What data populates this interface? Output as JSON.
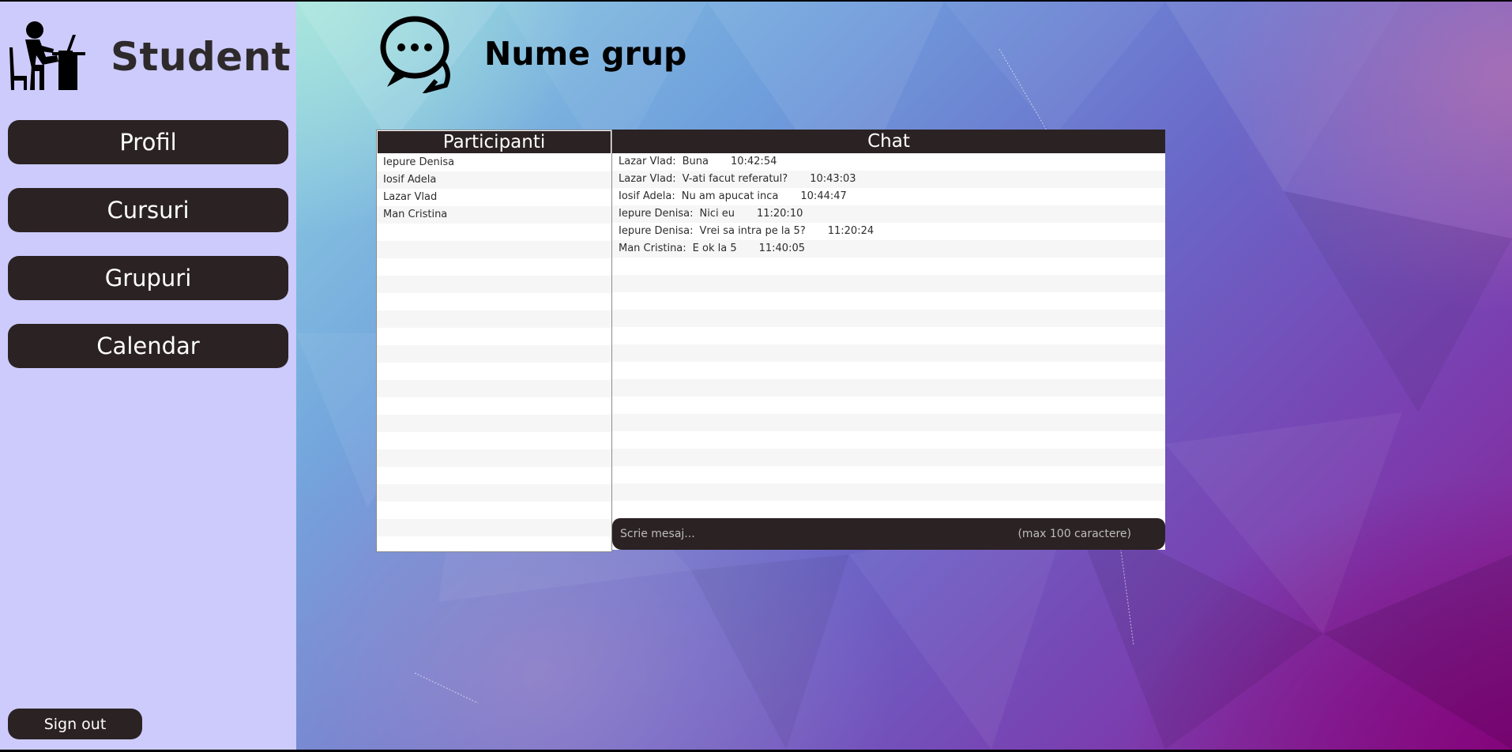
{
  "sidebar": {
    "brand_title": "Student",
    "brand_icon": "student-at-desk-icon",
    "nav": {
      "profil": "Profil",
      "cursuri": "Cursuri",
      "grupuri": "Grupuri",
      "calendar": "Calendar"
    },
    "sign_out": "Sign out"
  },
  "header": {
    "group_title": "Nume grup",
    "group_icon": "chat-bubbles-icon"
  },
  "participants": {
    "title": "Participanti",
    "members": [
      "Iepure Denisa",
      "Iosif Adela",
      "Lazar Vlad",
      "Man Cristina"
    ]
  },
  "chat": {
    "title": "Chat",
    "messages": [
      {
        "author": "Lazar Vlad:",
        "text": "Buna",
        "time": "10:42:54"
      },
      {
        "author": "Lazar Vlad:",
        "text": "V-ati facut referatul?",
        "time": "10:43:03"
      },
      {
        "author": "Iosif Adela:",
        "text": "Nu am apucat inca",
        "time": "10:44:47"
      },
      {
        "author": "Iepure Denisa:",
        "text": "Nici eu",
        "time": "11:20:10"
      },
      {
        "author": "Iepure Denisa:",
        "text": "Vrei sa intra pe la 5?",
        "time": "11:20:24"
      },
      {
        "author": "Man Cristina:",
        "text": "E ok la 5",
        "time": "11:40:05"
      }
    ],
    "input_placeholder": "Scrie mesaj...",
    "input_limit": "(max 100 caractere)"
  },
  "colors": {
    "sidebar_bg": "#cccbfb",
    "button_bg": "#2b2223",
    "button_text": "#ffffff"
  }
}
